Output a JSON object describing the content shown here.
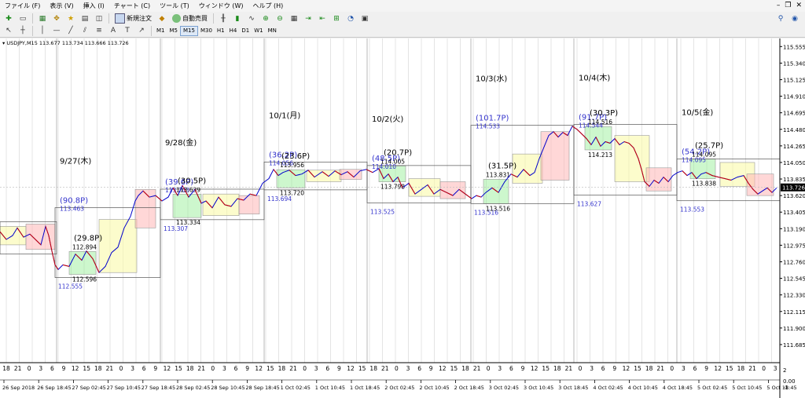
{
  "menu": [
    "ファイル (F)",
    "表示 (V)",
    "挿入 (I)",
    "チャート (C)",
    "ツール (T)",
    "ウィンドウ (W)",
    "ヘルプ (H)"
  ],
  "toolbar": {
    "new_order": "新規注文",
    "auto_trade": "自動売買"
  },
  "timeframes": [
    "M1",
    "M5",
    "M15",
    "M30",
    "H1",
    "H4",
    "D1",
    "W1",
    "MN"
  ],
  "selected_timeframe": "M15",
  "colors": {
    "up": "#0000cc",
    "down": "#cc0000",
    "label_blue": "#3333cc",
    "green_box": "rgba(144,238,144,0.45)",
    "yellow_box": "rgba(250,250,170,0.6)",
    "red_box": "rgba(255,182,182,0.55)",
    "price_tag": "#000000"
  },
  "chart_data": {
    "type": "line",
    "symbol_header": "USDJPY,M15  113.677 113.734 113.666 113.726",
    "current_price": "113.726",
    "y_ticks": [
      "115.555",
      "115.340",
      "115.125",
      "114.910",
      "114.695",
      "114.480",
      "114.265",
      "114.050",
      "113.835",
      "113.620",
      "113.405",
      "113.190",
      "112.975",
      "112.760",
      "112.545",
      "112.330",
      "112.115",
      "111.900",
      "111.685"
    ],
    "ylim": [
      111.45,
      115.66
    ],
    "x_hours": [
      "18",
      "21",
      "0",
      "3",
      "6",
      "9",
      "12",
      "15",
      "18",
      "21",
      "0",
      "3",
      "6",
      "9",
      "12",
      "15",
      "18",
      "21",
      "0",
      "3",
      "6",
      "9",
      "12",
      "15",
      "18",
      "21",
      "0",
      "3",
      "6",
      "9",
      "12",
      "15",
      "18",
      "21",
      "0",
      "3",
      "6",
      "9",
      "12",
      "15",
      "18",
      "21",
      "0",
      "3",
      "6",
      "9",
      "12",
      "15",
      "18",
      "21",
      "0",
      "3",
      "6",
      "9",
      "12",
      "15",
      "18",
      "21",
      "0",
      "3",
      "6",
      "9",
      "12",
      "15",
      "18",
      "21",
      "0",
      "3"
    ],
    "x_dates": [
      "26 Sep 2018",
      "26 Sep 18:45",
      "27 Sep 02:45",
      "27 Sep 10:45",
      "27 Sep 18:45",
      "28 Sep 02:45",
      "28 Sep 10:45",
      "28 Sep 18:45",
      "1 Oct 02:45",
      "1 Oct 10:45",
      "1 Oct 18:45",
      "2 Oct 02:45",
      "2 Oct 10:45",
      "2 Oct 18:45",
      "3 Oct 02:45",
      "3 Oct 10:45",
      "3 Oct 18:45",
      "4 Oct 02:45",
      "4 Oct 10:45",
      "4 Oct 18:45",
      "5 Oct 02:45",
      "5 Oct 10:45",
      "5 Oct 18:45"
    ],
    "macd_labels": [
      "2",
      "0.00",
      "-1"
    ],
    "days": [
      {
        "label": "9/27(木)",
        "range": "(90.8P)",
        "high": "113.463",
        "low": "112.555",
        "box_range": "(29.8P)",
        "box_high": "112.894",
        "box_low": "112.596"
      },
      {
        "label": "9/28(金)",
        "range": "(39.6P)",
        "high": "113.703",
        "low": "113.307",
        "box_range": "(30.5P)",
        "box_high": "113.639",
        "box_low": "113.334"
      },
      {
        "label": "10/1(月)",
        "range": "(36.2P)",
        "high": "114.056",
        "low": "113.694",
        "box_range": "(23.6P)",
        "box_high": "113.956",
        "box_low": "113.720"
      },
      {
        "label": "10/2(火)",
        "range": "(48.5P)",
        "high": "114.010",
        "low": "113.525",
        "box_range": "(20.7P)",
        "box_high": "114.005",
        "box_low": "113.798"
      },
      {
        "label": "10/3(水)",
        "range": "(101.7P)",
        "high": "114.533",
        "low": "113.516",
        "box_range": "(31.5P)",
        "box_high": "113.831",
        "box_low": "113.516"
      },
      {
        "label": "10/4(木)",
        "range": "(91.7P)",
        "high": "114.544",
        "low": "113.627",
        "box_range": "(30.3P)",
        "box_high": "114.516",
        "box_low": "114.213"
      },
      {
        "label": "10/5(金)",
        "range": "(54.2P)",
        "high": "114.095",
        "low": "113.553",
        "box_range": "(25.7P)",
        "box_high": "114.095",
        "box_low": "113.838"
      }
    ],
    "price_path": [
      [
        0,
        113.15
      ],
      [
        8,
        113.05
      ],
      [
        16,
        113.1
      ],
      [
        22,
        113.2
      ],
      [
        30,
        113.08
      ],
      [
        38,
        113.12
      ],
      [
        45,
        113.05
      ],
      [
        52,
        112.98
      ],
      [
        58,
        113.22
      ],
      [
        62,
        113.1
      ],
      [
        66,
        112.9
      ],
      [
        70,
        112.72
      ],
      [
        74,
        112.66
      ],
      [
        80,
        112.72
      ],
      [
        88,
        112.7
      ],
      [
        96,
        112.86
      ],
      [
        104,
        112.78
      ],
      [
        110,
        112.9
      ],
      [
        118,
        112.8
      ],
      [
        126,
        112.62
      ],
      [
        134,
        112.7
      ],
      [
        142,
        112.88
      ],
      [
        150,
        112.95
      ],
      [
        158,
        113.2
      ],
      [
        166,
        113.35
      ],
      [
        172,
        113.55
      ],
      [
        176,
        113.62
      ],
      [
        182,
        113.68
      ],
      [
        190,
        113.6
      ],
      [
        198,
        113.62
      ],
      [
        206,
        113.55
      ],
      [
        214,
        113.6
      ],
      [
        220,
        113.72
      ],
      [
        226,
        113.62
      ],
      [
        232,
        113.75
      ],
      [
        240,
        113.6
      ],
      [
        248,
        113.7
      ],
      [
        256,
        113.52
      ],
      [
        262,
        113.55
      ],
      [
        270,
        113.46
      ],
      [
        278,
        113.6
      ],
      [
        286,
        113.5
      ],
      [
        294,
        113.48
      ],
      [
        302,
        113.58
      ],
      [
        310,
        113.56
      ],
      [
        318,
        113.64
      ],
      [
        326,
        113.62
      ],
      [
        334,
        113.78
      ],
      [
        342,
        113.84
      ],
      [
        348,
        113.96
      ],
      [
        354,
        113.88
      ],
      [
        360,
        113.92
      ],
      [
        368,
        113.95
      ],
      [
        376,
        113.88
      ],
      [
        384,
        113.9
      ],
      [
        392,
        113.95
      ],
      [
        400,
        113.86
      ],
      [
        410,
        113.93
      ],
      [
        418,
        113.87
      ],
      [
        426,
        113.94
      ],
      [
        434,
        113.89
      ],
      [
        442,
        113.93
      ],
      [
        450,
        113.86
      ],
      [
        458,
        113.94
      ],
      [
        466,
        113.96
      ],
      [
        474,
        113.92
      ],
      [
        482,
        113.97
      ],
      [
        488,
        113.84
      ],
      [
        494,
        113.9
      ],
      [
        500,
        113.8
      ],
      [
        506,
        113.86
      ],
      [
        512,
        113.72
      ],
      [
        520,
        113.78
      ],
      [
        528,
        113.64
      ],
      [
        536,
        113.7
      ],
      [
        544,
        113.76
      ],
      [
        552,
        113.64
      ],
      [
        560,
        113.7
      ],
      [
        568,
        113.66
      ],
      [
        576,
        113.62
      ],
      [
        584,
        113.7
      ],
      [
        592,
        113.64
      ],
      [
        600,
        113.58
      ],
      [
        606,
        113.62
      ],
      [
        612,
        113.6
      ],
      [
        618,
        113.66
      ],
      [
        626,
        113.72
      ],
      [
        634,
        113.66
      ],
      [
        642,
        113.8
      ],
      [
        650,
        113.9
      ],
      [
        658,
        113.86
      ],
      [
        666,
        113.96
      ],
      [
        674,
        113.88
      ],
      [
        680,
        113.92
      ],
      [
        686,
        114.1
      ],
      [
        692,
        114.25
      ],
      [
        698,
        114.4
      ],
      [
        704,
        114.45
      ],
      [
        710,
        114.38
      ],
      [
        716,
        114.44
      ],
      [
        722,
        114.4
      ],
      [
        728,
        114.52
      ],
      [
        734,
        114.48
      ],
      [
        740,
        114.42
      ],
      [
        746,
        114.36
      ],
      [
        752,
        114.28
      ],
      [
        758,
        114.38
      ],
      [
        764,
        114.26
      ],
      [
        770,
        114.32
      ],
      [
        776,
        114.3
      ],
      [
        782,
        114.36
      ],
      [
        788,
        114.28
      ],
      [
        794,
        114.32
      ],
      [
        800,
        114.3
      ],
      [
        806,
        114.24
      ],
      [
        812,
        114.1
      ],
      [
        816,
        113.96
      ],
      [
        820,
        113.8
      ],
      [
        826,
        113.74
      ],
      [
        832,
        113.82
      ],
      [
        838,
        113.78
      ],
      [
        844,
        113.86
      ],
      [
        850,
        113.8
      ],
      [
        856,
        113.88
      ],
      [
        862,
        113.92
      ],
      [
        868,
        113.94
      ],
      [
        874,
        113.88
      ],
      [
        880,
        113.92
      ],
      [
        886,
        113.84
      ],
      [
        892,
        113.9
      ],
      [
        898,
        113.92
      ],
      [
        906,
        113.88
      ],
      [
        914,
        113.86
      ],
      [
        922,
        113.84
      ],
      [
        930,
        113.82
      ],
      [
        938,
        113.86
      ],
      [
        946,
        113.88
      ],
      [
        952,
        113.78
      ],
      [
        958,
        113.7
      ],
      [
        964,
        113.64
      ],
      [
        970,
        113.68
      ],
      [
        976,
        113.72
      ],
      [
        982,
        113.66
      ],
      [
        988,
        113.72
      ]
    ]
  }
}
